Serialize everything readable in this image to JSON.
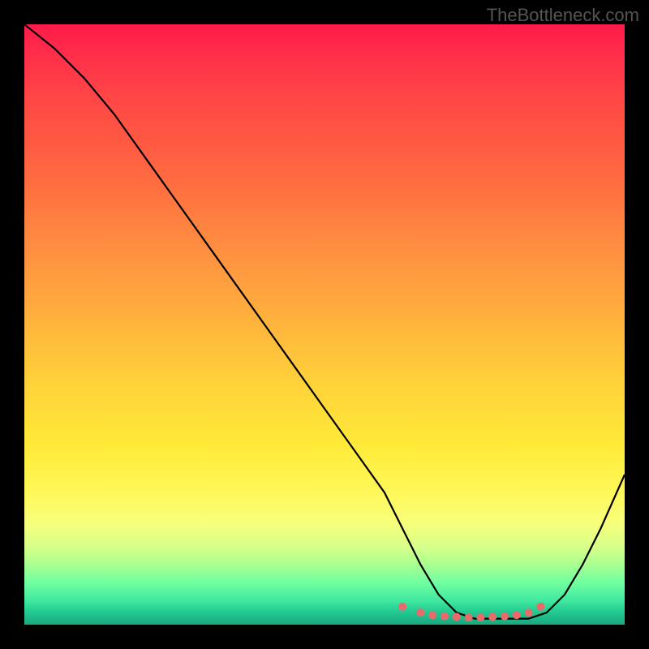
{
  "watermark": "TheBottleneck.com",
  "chart_data": {
    "type": "line",
    "title": "",
    "xlabel": "",
    "ylabel": "",
    "xlim": [
      0,
      100
    ],
    "ylim": [
      0,
      100
    ],
    "series": [
      {
        "name": "curve",
        "x": [
          0,
          5,
          10,
          15,
          20,
          25,
          30,
          35,
          40,
          45,
          50,
          55,
          60,
          63,
          66,
          69,
          72,
          75,
          78,
          81,
          84,
          87,
          90,
          93,
          96,
          100
        ],
        "values": [
          100,
          96,
          91,
          85,
          78,
          71,
          64,
          57,
          50,
          43,
          36,
          29,
          22,
          16,
          10,
          5,
          2,
          1,
          1,
          1,
          1,
          2,
          5,
          10,
          16,
          25
        ]
      }
    ],
    "markers": {
      "name": "dots",
      "x": [
        63,
        66,
        68,
        70,
        72,
        74,
        76,
        78,
        80,
        82,
        84,
        86
      ],
      "values": [
        3,
        2,
        1.6,
        1.4,
        1.3,
        1.2,
        1.2,
        1.3,
        1.4,
        1.6,
        2,
        3
      ],
      "color": "#e86a6a",
      "radius": 5
    },
    "gradient_stops": [
      {
        "pos": 0,
        "color": "#ff1a4a"
      },
      {
        "pos": 50,
        "color": "#ffb43c"
      },
      {
        "pos": 78,
        "color": "#fff85a"
      },
      {
        "pos": 93,
        "color": "#70ffa0"
      },
      {
        "pos": 100,
        "color": "#1aa880"
      }
    ]
  }
}
